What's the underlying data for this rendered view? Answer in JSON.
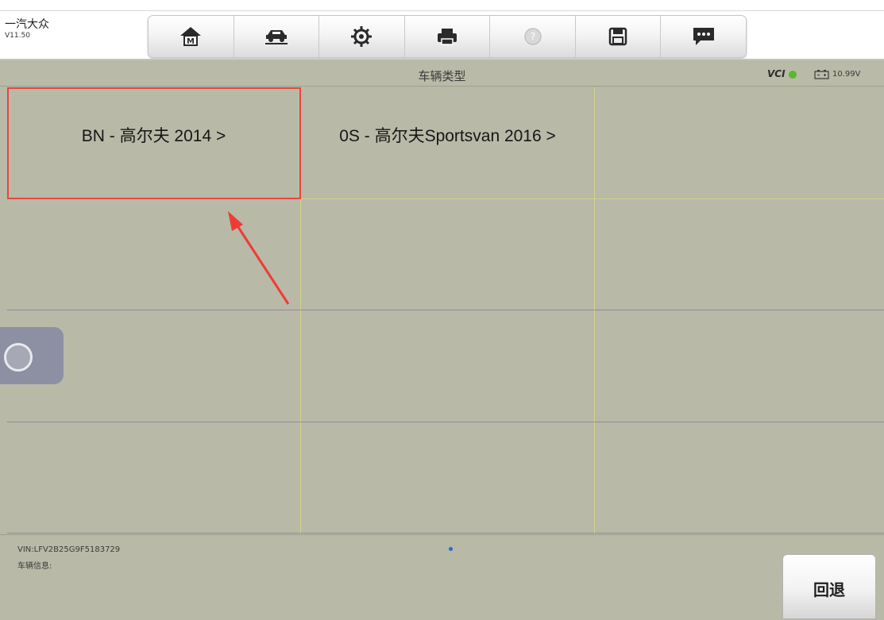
{
  "header": {
    "app_title": "一汽大众",
    "version": "V11.50"
  },
  "toolbar": [
    {
      "name": "home-button",
      "icon": "home-m-icon"
    },
    {
      "name": "vehicle-button",
      "icon": "car-lift-icon"
    },
    {
      "name": "settings-button",
      "icon": "gear-icon"
    },
    {
      "name": "print-button",
      "icon": "printer-icon"
    },
    {
      "name": "help-button",
      "icon": "help-icon"
    },
    {
      "name": "save-button",
      "icon": "floppy-disk-icon"
    },
    {
      "name": "feedback-button",
      "icon": "chat-bubble-icon"
    }
  ],
  "titlebar": {
    "title": "车辆类型",
    "vci_label": "VCI",
    "voltage": "10.99V"
  },
  "grid": {
    "cells": [
      {
        "label": "BN - 高尔夫 2014 >",
        "selected": true
      },
      {
        "label": "0S - 高尔夫Sportsvan 2016 >",
        "selected": false
      },
      {
        "label": "",
        "selected": false
      },
      {
        "label": "",
        "selected": false
      },
      {
        "label": "",
        "selected": false
      },
      {
        "label": "",
        "selected": false
      },
      {
        "label": "",
        "selected": false
      },
      {
        "label": "",
        "selected": false
      },
      {
        "label": "",
        "selected": false
      },
      {
        "label": "",
        "selected": false
      },
      {
        "label": "",
        "selected": false
      },
      {
        "label": "",
        "selected": false
      }
    ]
  },
  "footer": {
    "vin": "VIN:LFV2B25G9F5183729",
    "vehicle_info": "车辆信息:",
    "back_label": "回退"
  },
  "colors": {
    "background": "#b8b9a7",
    "selection_outline": "#e8473f",
    "annotation_arrow": "#ef3b35",
    "vci_ok": "#59b830",
    "page_indicator": "#1d6fd1"
  }
}
